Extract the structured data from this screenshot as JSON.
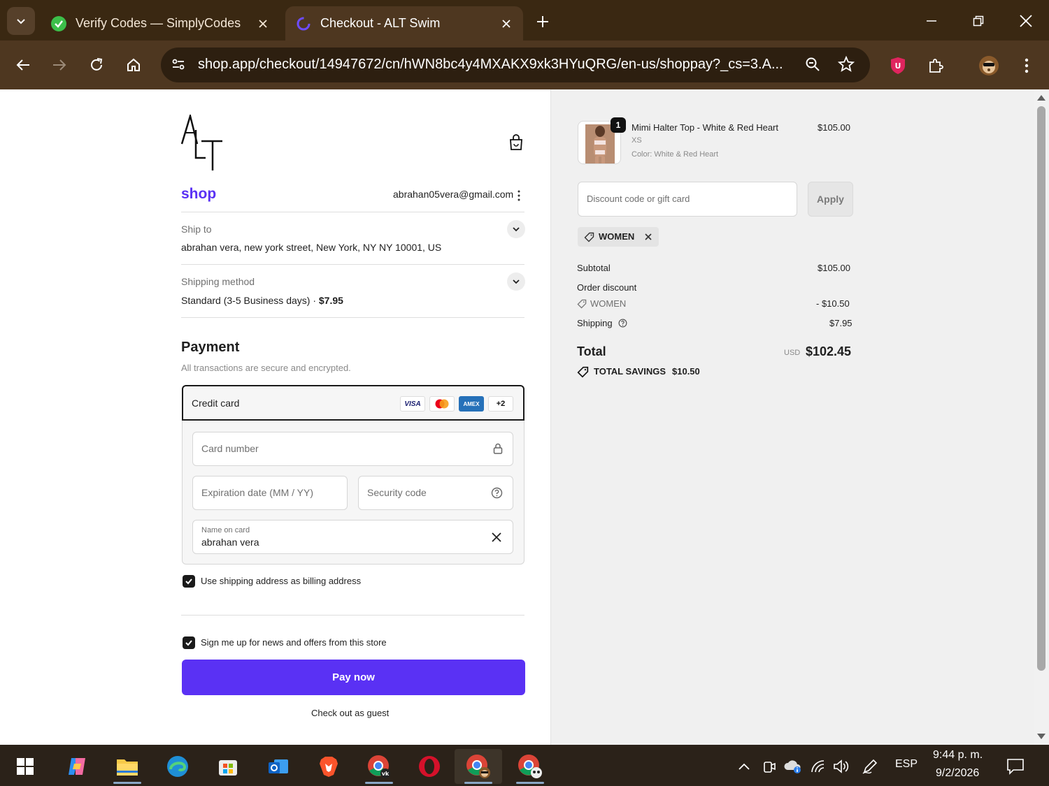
{
  "browser": {
    "tabs": [
      {
        "title": "Verify Codes — SimplyCodes",
        "active": false
      },
      {
        "title": "Checkout - ALT Swim",
        "active": true
      }
    ],
    "url": "shop.app/checkout/14947672/cn/hWN8bc4y4MXAKX9xk3HYuQRG/en-us/shoppay?_cs=3.A...",
    "colors": {
      "chrome": "#4e3720",
      "tabstrip": "#3a2812",
      "omnibox": "#2d1f10"
    }
  },
  "checkout": {
    "logo_text": "ALT",
    "shop_brand": "shop",
    "account_email": "abrahan05vera@gmail.com",
    "ship_to": {
      "label": "Ship to",
      "value": "abrahan vera, new york street, New York, NY NY 10001, US"
    },
    "shipping_method": {
      "label": "Shipping method",
      "value": "Standard (3-5 Business days) · ",
      "price": "$7.95"
    },
    "payment": {
      "heading": "Payment",
      "subtitle": "All transactions are secure and encrypted.",
      "method_label": "Credit card",
      "brands": [
        "VISA",
        "mastercard",
        "AMEX",
        "+2"
      ],
      "card_number_placeholder": "Card number",
      "expiration_placeholder": "Expiration date (MM / YY)",
      "security_placeholder": "Security code",
      "name_label": "Name on card",
      "name_value": "abrahan vera"
    },
    "billing_checkbox": {
      "label": "Use shipping address as billing address",
      "checked": true
    },
    "newsletter_checkbox": {
      "label": "Sign me up for news and offers from this store",
      "checked": true
    },
    "pay_button": "Pay now",
    "guest_link": "Check out as guest",
    "accent_color": "#5a31f4"
  },
  "summary": {
    "item": {
      "quantity": "1",
      "name": "Mimi Halter Top - White & Red Heart",
      "size": "XS",
      "color": "Color: White & Red Heart",
      "price": "$105.00"
    },
    "discount_placeholder": "Discount code or gift card",
    "apply_label": "Apply",
    "applied_code": "WOMEN",
    "subtotal_label": "Subtotal",
    "subtotal_value": "$105.00",
    "order_discount_label": "Order discount",
    "discount_code": "WOMEN",
    "discount_value": "- $10.50",
    "shipping_label": "Shipping",
    "shipping_value": "$7.95",
    "total_label": "Total",
    "currency": "USD",
    "total_value": "$102.45",
    "savings_label": "TOTAL SAVINGS",
    "savings_value": "$10.50"
  },
  "taskbar": {
    "language": "ESP",
    "time": "9:44 p. m.",
    "date": "9/2/2026"
  }
}
